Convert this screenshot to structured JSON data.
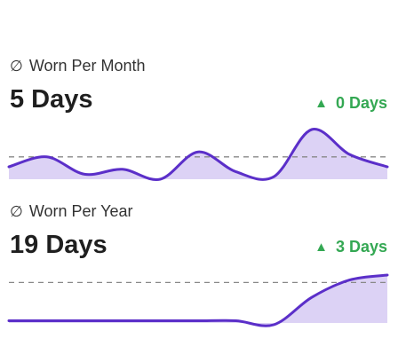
{
  "stats": [
    {
      "id": "month",
      "label": "Worn Per Month",
      "label_icon": "empty-set-icon",
      "value": "5 Days",
      "change": "0 Days",
      "change_icon": "triangle-up-icon",
      "trend": [
        0.25,
        0.45,
        0.1,
        0.2,
        0.0,
        0.55,
        0.15,
        0.05,
        1.0,
        0.5,
        0.25
      ],
      "baseline": 0.45
    },
    {
      "id": "year",
      "label": "Worn Per Year",
      "label_icon": "empty-set-icon",
      "value": "19 Days",
      "change": "3 Days",
      "change_icon": "triangle-up-icon",
      "trend": [
        0.08,
        0.08,
        0.08,
        0.08,
        0.08,
        0.08,
        0.08,
        0.0,
        0.55,
        0.9,
        1.0
      ],
      "baseline": 0.85
    }
  ],
  "colors": {
    "line": "#5b2fc9",
    "fill": "#dcd2f5",
    "positive": "#34a853",
    "baseline": "#888888"
  }
}
